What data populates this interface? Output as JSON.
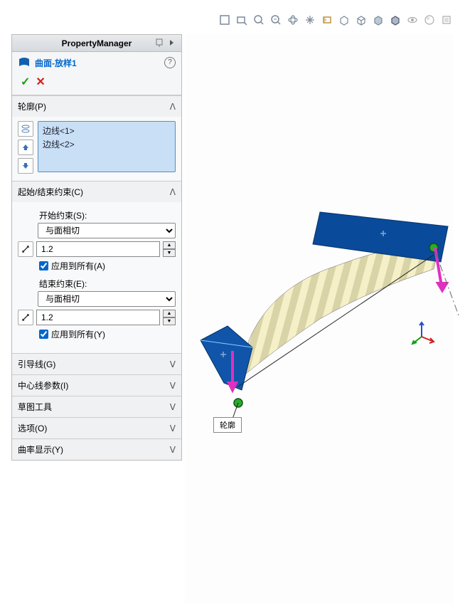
{
  "panel": {
    "title": "PropertyManager",
    "feature_name": "曲面-放样1"
  },
  "profiles": {
    "header": "轮廓(P)",
    "items": [
      "边线<1>",
      "边线<2>"
    ]
  },
  "constraints": {
    "header": "起始/结束约束(C)",
    "start_label": "开始约束(S):",
    "start_value": "与面相切",
    "start_spinner": "1.2",
    "apply_all_start": "应用到所有(A)",
    "end_label": "结束约束(E):",
    "end_value": "与面相切",
    "end_spinner": "1.2",
    "apply_all_end": "应用到所有(Y)"
  },
  "sections": {
    "guide": "引导线(G)",
    "centerline": "中心线参数(I)",
    "sketch_tools": "草图工具",
    "options": "选项(O)",
    "curvature": "曲率显示(Y)"
  },
  "viewport": {
    "callout": "轮廓"
  }
}
